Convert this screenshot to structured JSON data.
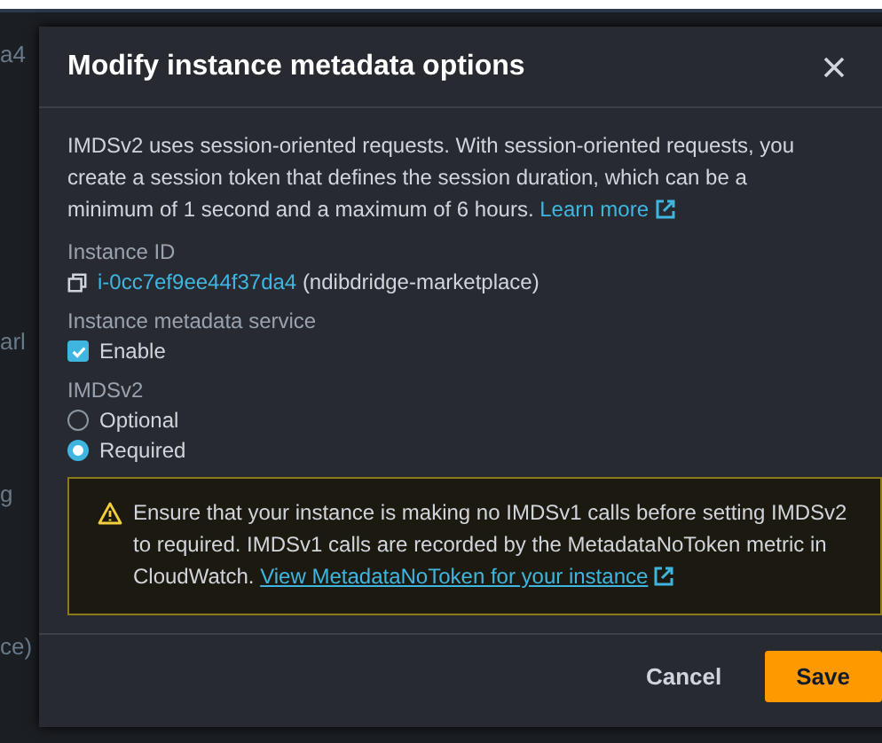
{
  "background_fragments": [
    "a4",
    "arl",
    "g",
    "ce)"
  ],
  "dialog": {
    "title": "Modify instance metadata options",
    "intro": "IMDSv2 uses session-oriented requests. With session-oriented requests, you create a session token that defines the session duration, which can be a minimum of 1 second and a maximum of 6 hours.",
    "intro_link": "Learn more",
    "instance_id": {
      "label": "Instance ID",
      "id": "i-0cc7ef9ee44f37da4",
      "name": "(ndibdridge-marketplace)"
    },
    "metadata_service": {
      "label": "Instance metadata service",
      "checkbox": {
        "label": "Enable",
        "checked": true
      }
    },
    "imdsv2": {
      "label": "IMDSv2",
      "options": [
        {
          "label": "Optional",
          "selected": false
        },
        {
          "label": "Required",
          "selected": true
        }
      ]
    },
    "warning": {
      "text": "Ensure that your instance is making no IMDSv1 calls before setting IMDSv2 to required. IMDSv1 calls are recorded by the MetadataNoToken metric in CloudWatch.",
      "link": "View MetadataNoToken for your instance"
    },
    "buttons": [
      {
        "label": "Cancel",
        "kind": "link"
      },
      {
        "label": "Save",
        "kind": "primary"
      }
    ]
  }
}
